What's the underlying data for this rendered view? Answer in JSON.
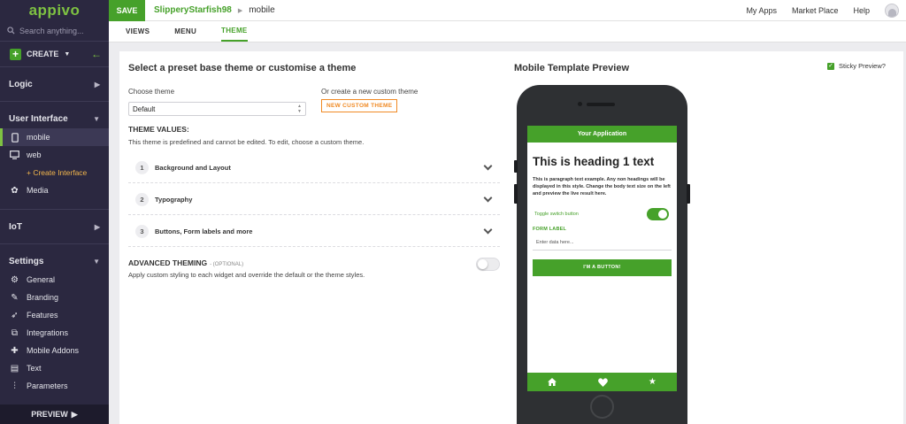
{
  "sidebar": {
    "logo": "appivo",
    "search_placeholder": "Search anything...",
    "create_label": "CREATE",
    "sections": {
      "logic": "Logic",
      "user_interface": "User Interface",
      "iot": "IoT",
      "settings": "Settings"
    },
    "ui_items": [
      {
        "label": "mobile",
        "icon": "phone-icon"
      },
      {
        "label": "web",
        "icon": "monitor-icon"
      },
      {
        "label": "+ Create Interface"
      },
      {
        "label": "Media",
        "icon": "media-icon"
      }
    ],
    "settings_items": [
      {
        "label": "General",
        "icon": "gear-icon"
      },
      {
        "label": "Branding",
        "icon": "brush-icon"
      },
      {
        "label": "Features",
        "icon": "rocket-icon"
      },
      {
        "label": "Integrations",
        "icon": "integrations-icon"
      },
      {
        "label": "Mobile Addons",
        "icon": "puzzle-icon"
      },
      {
        "label": "Text",
        "icon": "document-icon"
      },
      {
        "label": "Parameters",
        "icon": "sliders-icon"
      }
    ],
    "preview_label": "PREVIEW"
  },
  "topbar": {
    "save_label": "SAVE",
    "app_name": "SlipperyStarfish98",
    "current": "mobile",
    "nav": [
      "My Apps",
      "Market Place",
      "Help"
    ]
  },
  "tabs": [
    "VIEWS",
    "MENU",
    "THEME"
  ],
  "theme": {
    "heading": "Select a preset base theme or customise a theme",
    "choose_label": "Choose theme",
    "selected_theme": "Default",
    "custom_label": "Or create a new custom theme",
    "new_custom_button": "NEW CUSTOM THEME",
    "values_heading": "THEME VALUES:",
    "values_desc": "This theme is predefined and cannot be edited. To edit, choose a custom theme.",
    "sections": [
      {
        "num": "1",
        "title": "Background and Layout"
      },
      {
        "num": "2",
        "title": "Typography"
      },
      {
        "num": "3",
        "title": "Buttons, Form labels and more"
      }
    ],
    "advanced_heading": "ADVANCED THEMING",
    "advanced_optional": "- (OPTIONAL)",
    "advanced_desc": "Apply custom styling to each widget and override the default or the theme styles."
  },
  "preview": {
    "heading": "Mobile Template Preview",
    "sticky_label": "Sticky Preview?",
    "sticky_checked": true,
    "app_title": "Your Application",
    "h1": "This is heading 1 text",
    "paragraph": "This is paragraph text example. Any non headings will be displayed in this style. Change the body text size on the left and preview the live result here.",
    "toggle_label": "Toggle switch button",
    "form_label": "FORM LABEL",
    "input_placeholder": "Enter data here...",
    "button_label": "I'M A BUTTON!",
    "bottom_nav_icons": [
      "home-icon",
      "heart-icon",
      "star-icon"
    ]
  },
  "colors": {
    "accent": "#46a12a",
    "sidebar_bg": "#2b2840",
    "orange": "#f08a24",
    "link_yellow": "#f3b64c"
  }
}
